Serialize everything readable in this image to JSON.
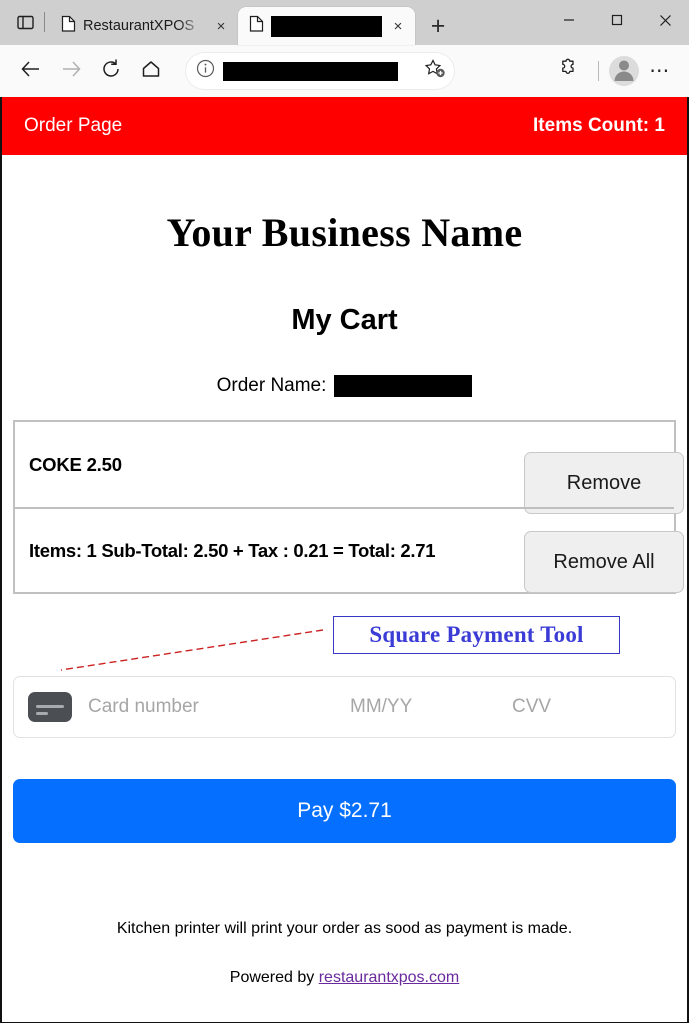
{
  "browser": {
    "tab_list_icon": "tab-list-icon",
    "tabs": [
      {
        "title": "RestaurantXPOS",
        "favicon": "page-icon",
        "redacted": false,
        "active": false,
        "close_label": "×"
      },
      {
        "title": "",
        "favicon": "page-icon",
        "redacted": true,
        "active": true,
        "close_label": "×"
      }
    ],
    "new_tab_label": "+",
    "window_controls": {
      "minimize": "minimize-icon",
      "maximize": "maximize-icon",
      "close": "close-icon"
    },
    "toolbar": {
      "back_icon": "back-arrow-icon",
      "forward_icon": "forward-arrow-icon",
      "reload_icon": "reload-icon",
      "home_icon": "home-icon",
      "site_info_icon": "info-circle-icon",
      "address_value": "",
      "address_redacted": true,
      "favorite_icon": "star-add-icon",
      "extensions_icon": "puzzle-piece-icon",
      "profile_icon": "avatar-icon",
      "settings_icon": "ellipsis-icon",
      "settings_label": "⋯"
    }
  },
  "site": {
    "header": {
      "title": "Order Page",
      "items_count_label": "Items Count:",
      "items_count_value": "1",
      "background_color": "#ff0000",
      "text_color": "#ffffff"
    },
    "business_name": "Your Business Name",
    "cart_title": "My Cart",
    "order_name": {
      "label": "Order Name:",
      "value": "",
      "redacted": true
    },
    "cart": {
      "rows": [
        {
          "description": "COKE 2.50",
          "button_label": "Remove"
        },
        {
          "description": "Items: 1 Sub-Total: 2.50 + Tax : 0.21 = Total: 2.71",
          "button_label": "Remove All"
        }
      ]
    },
    "annotation": {
      "text": "Square Payment Tool",
      "border_color": "#3838c4",
      "text_color": "#3b3bd6",
      "arrow_color": "#cc2222"
    },
    "payment_form": {
      "card_icon": "credit-card-icon",
      "card_number_placeholder": "Card number",
      "expiry_placeholder": "MM/YY",
      "cvv_placeholder": "CVV"
    },
    "pay_button": {
      "label": "Pay $2.71",
      "color": "#0570ff"
    },
    "footer": {
      "note": "Kitchen printer will print your order as sood as payment is made.",
      "powered_prefix": "Powered by",
      "powered_link": "restaurantxpos.com",
      "link_color": "#6a2a9e"
    }
  }
}
